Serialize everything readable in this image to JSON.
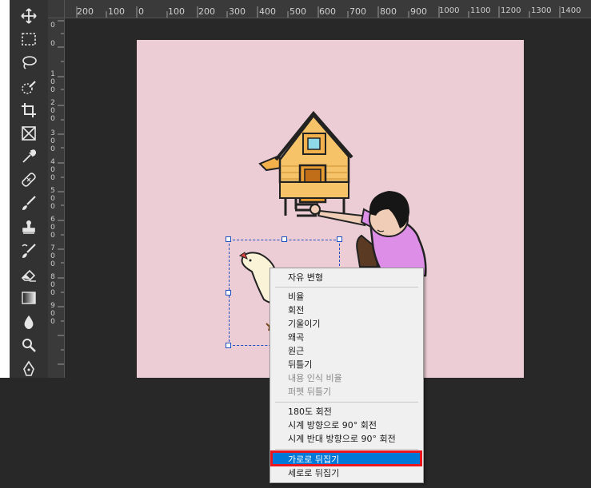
{
  "ruler": {
    "top_labels": [
      "200",
      "100",
      "0",
      "100",
      "200",
      "300",
      "400",
      "500",
      "600",
      "700",
      "800",
      "900",
      "1000",
      "1100",
      "1200",
      "1300",
      "1400"
    ],
    "left_labels": [
      "0",
      "1\n0\n0",
      "2\n0\n0",
      "3\n0\n0",
      "4\n0\n0",
      "5\n0\n0",
      "6\n0\n0",
      "7\n0\n0",
      "8\n0\n0",
      "9\n0\n0"
    ]
  },
  "toolbar": {
    "tools": [
      "move-tool",
      "marquee-tool",
      "lasso-tool",
      "quick-selection-tool",
      "crop-tool",
      "frame-tool",
      "eyedropper-tool",
      "healing-brush-tool",
      "brush-tool",
      "clone-stamp-tool",
      "history-brush-tool",
      "eraser-tool",
      "gradient-tool",
      "blur-tool",
      "dodge-tool",
      "pen-tool"
    ]
  },
  "context_menu": {
    "free_transform": "자유 변형",
    "scale": "비율",
    "rotate": "회전",
    "skew": "기울이기",
    "distort": "왜곡",
    "perspective": "원근",
    "warp": "뒤틀기",
    "content_aware_scale": "내용 인식 비율",
    "puppet_warp": "퍼펫 뒤틀기",
    "rotate_180": "180도 회전",
    "rotate_cw": "시계 방향으로 90° 회전",
    "rotate_ccw": "시계 반대 방향으로 90° 회전",
    "flip_horizontal": "가로로 뒤집기",
    "flip_vertical": "세로로 뒤집기"
  },
  "colors": {
    "canvas_bg": "#eccdd6",
    "highlight": "#0078d7",
    "annotation_red": "#e8171f"
  }
}
